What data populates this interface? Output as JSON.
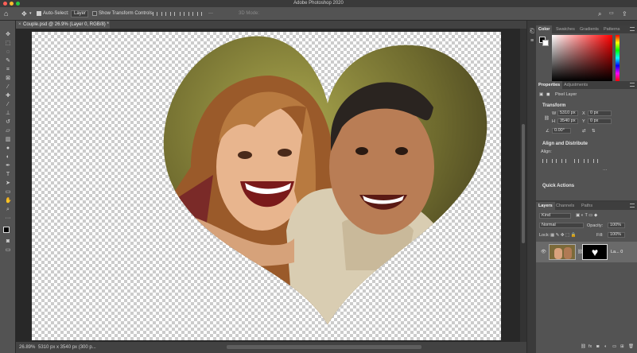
{
  "window": {
    "title": "Adobe Photoshop 2020"
  },
  "colors": {
    "accent_red": "#ff5f57",
    "accent_yellow": "#febc2e",
    "accent_green": "#28c840",
    "canvas_check": "#cccccc"
  },
  "options_bar": {
    "auto_select_label": "Auto-Select:",
    "auto_select_value": "Layer",
    "show_transform_label": "Show Transform Controls",
    "mode_3d_label": "3D Mode:"
  },
  "document": {
    "tab_title": "Couple.psd @ 26.9% (Layer 0, RGB/8) *",
    "zoom": "26.89%",
    "status": "5310 px x 3540 px (300 p..."
  },
  "color_panel": {
    "tabs": [
      "Color",
      "Swatches",
      "Gradients",
      "Patterns"
    ]
  },
  "properties_panel": {
    "tabs": [
      "Properties",
      "Adjustments"
    ],
    "layer_type": "Pixel Layer",
    "transform_label": "Transform",
    "w_label": "W",
    "w_value": "5310 px",
    "h_label": "H",
    "h_value": "3540 px",
    "x_label": "X",
    "x_value": "0 px",
    "y_label": "Y",
    "y_value": "0 px",
    "angle_value": "0.00°",
    "align_label": "Align and Distribute",
    "align_sub": "Align:",
    "quick_actions": "Quick Actions"
  },
  "layers_panel": {
    "tabs": [
      "Layers",
      "Channels",
      "Paths"
    ],
    "filter_kind": "Kind",
    "blend_mode": "Normal",
    "opacity_label": "Opacity:",
    "opacity_value": "100%",
    "lock_label": "Lock:",
    "fill_label": "Fill:",
    "fill_value": "100%",
    "layer_name": "La... 0"
  }
}
